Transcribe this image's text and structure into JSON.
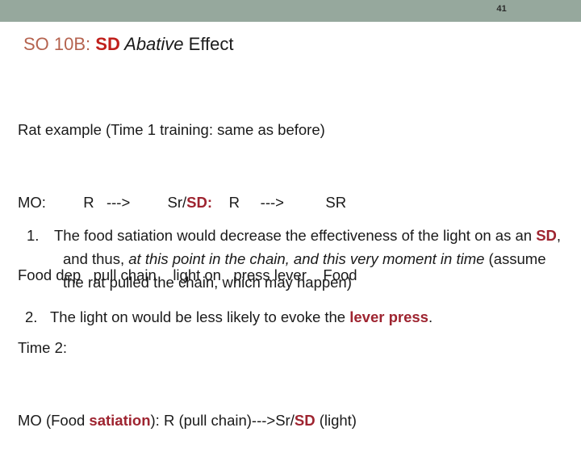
{
  "header": {
    "page_number": "41",
    "bar_color": "#96a89d"
  },
  "title": {
    "prefix": "SO 10B: ",
    "sd": "SD",
    "emphasis": " Abative",
    "suffix": " Effect",
    "prefix_color": "#b5634f",
    "sd_color": "#c0201c",
    "text_color": "#1a1a1a"
  },
  "body": {
    "line1": "Rat example (Time 1 training: same as before)",
    "line2_a": "MO:         R   --->         Sr/",
    "line2_sd": "SD:",
    "line2_b": "    R     --->          SR",
    "line3": "Food dep   pull chain    light on   press lever    Food",
    "line4": "Time 2:",
    "line5_a": "MO (Food ",
    "line5_satiation": "satiation",
    "line5_b": "): R (pull chain)--->Sr/",
    "line5_sd": "SD",
    "line5_c": " (light)",
    "accent_color": "#9e2430"
  },
  "list": {
    "items": [
      {
        "marker": "1.",
        "part_a": "The food satiation would decrease the  effectiveness of  the light on as an ",
        "part_sd": "SD",
        "part_b": ", and thus, ",
        "part_italic": "at this point in the chain, and this very moment in time",
        "part_c": " (assume the rat pulled the chain, which may happen)"
      },
      {
        "marker": "2.",
        "part_a": "The light on would be less likely to evoke the ",
        "part_bold": "lever press",
        "part_b": "."
      }
    ]
  }
}
